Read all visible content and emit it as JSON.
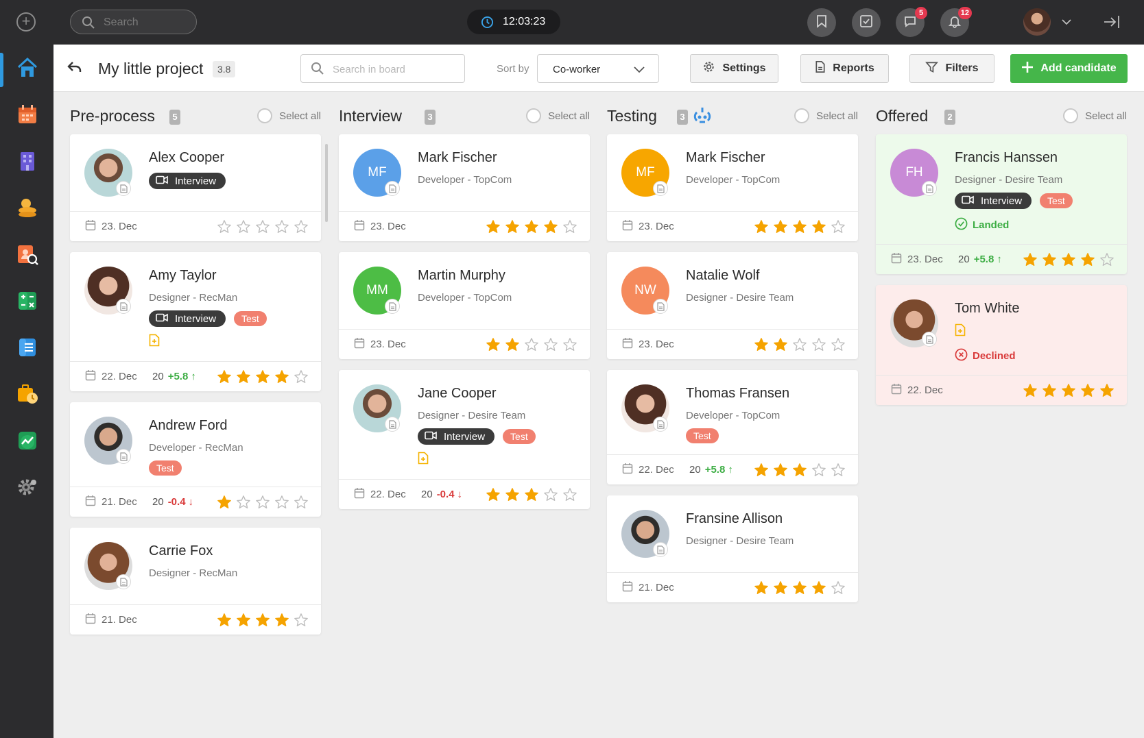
{
  "topbar": {
    "search_placeholder": "Search",
    "clock": "12:03:23",
    "messages_badge": "5",
    "notifications_badge": "12"
  },
  "header": {
    "project_title": "My little project",
    "project_score": "3.8",
    "board_search_placeholder": "Search in board",
    "sort_label": "Sort by",
    "sort_value": "Co-worker",
    "settings_label": "Settings",
    "reports_label": "Reports",
    "filters_label": "Filters",
    "add_label": "Add candidate"
  },
  "colors": {
    "accent_green": "#45b64a",
    "active_blue": "#2f9ae0",
    "star_gold": "#f5a300",
    "test_tag": "#f1806f"
  },
  "columns": [
    {
      "title": "Pre-process",
      "count": "5",
      "select_all": "Select all",
      "cards": [
        {
          "name": "Alex Cooper",
          "role": "",
          "tags": [
            "Interview"
          ],
          "date": "23. Dec",
          "rating": 0,
          "photo": true
        },
        {
          "name": "Amy Taylor",
          "role": "Designer - RecMan",
          "tags": [
            "Interview",
            "Test"
          ],
          "doc_plus": true,
          "date": "22. Dec",
          "score": "20",
          "delta": "+5.8",
          "rating": 4,
          "photo": true
        },
        {
          "name": "Andrew Ford",
          "role": "Developer - RecMan",
          "tags": [
            "Test"
          ],
          "date": "21. Dec",
          "score": "20",
          "delta": "-0.4",
          "rating": 1,
          "photo": true
        },
        {
          "name": "Carrie Fox",
          "role": "Designer - RecMan",
          "tags": [],
          "date": "21. Dec",
          "rating": 4,
          "photo": true
        }
      ]
    },
    {
      "title": "Interview",
      "count": "3",
      "select_all": "Select all",
      "cards": [
        {
          "name": "Mark Fischer",
          "role": "Developer - TopCom",
          "initials": "MF",
          "avatar_color": "#5ba0e8",
          "tags": [],
          "date": "23. Dec",
          "rating": 4
        },
        {
          "name": "Martin Murphy",
          "role": "Developer - TopCom",
          "initials": "MM",
          "avatar_color": "#4dbd45",
          "tags": [],
          "date": "23. Dec",
          "rating": 2
        },
        {
          "name": "Jane Cooper",
          "role": "Designer - Desire Team",
          "tags": [
            "Interview",
            "Test"
          ],
          "doc_plus": true,
          "date": "22. Dec",
          "score": "20",
          "delta": "-0.4",
          "rating": 3,
          "photo": true
        }
      ]
    },
    {
      "title": "Testing",
      "count": "3",
      "select_all": "Select all",
      "cards": [
        {
          "name": "Mark Fischer",
          "role": "Developer - TopCom",
          "initials": "MF",
          "avatar_color": "#f7a600",
          "tags": [],
          "date": "23. Dec",
          "rating": 4
        },
        {
          "name": "Natalie Wolf",
          "role": "Designer - Desire Team",
          "initials": "NW",
          "avatar_color": "#f58a5c",
          "tags": [],
          "date": "23. Dec",
          "rating": 2
        },
        {
          "name": "Thomas Fransen",
          "role": "Developer - TopCom",
          "tags": [
            "Test"
          ],
          "date": "22. Dec",
          "score": "20",
          "delta": "+5.8",
          "rating": 3,
          "photo": true
        },
        {
          "name": "Fransine Allison",
          "role": "Designer - Desire Team",
          "tags": [],
          "date": "21. Dec",
          "rating": 4,
          "photo": true
        }
      ]
    },
    {
      "title": "Offered",
      "count": "2",
      "select_all": "Select all",
      "cards": [
        {
          "name": "Francis Hanssen",
          "role": "Designer - Desire Team",
          "initials": "FH",
          "avatar_color": "#c88ad6",
          "tags": [
            "Interview",
            "Test"
          ],
          "status": "Landed",
          "bg": "green",
          "date": "23. Dec",
          "score": "20",
          "delta": "+5.8",
          "rating": 4
        },
        {
          "name": "Tom White",
          "role": "",
          "tags": [],
          "doc_plus": true,
          "status": "Declined",
          "bg": "red",
          "date": "22. Dec",
          "rating": 5,
          "photo": true
        }
      ]
    }
  ]
}
